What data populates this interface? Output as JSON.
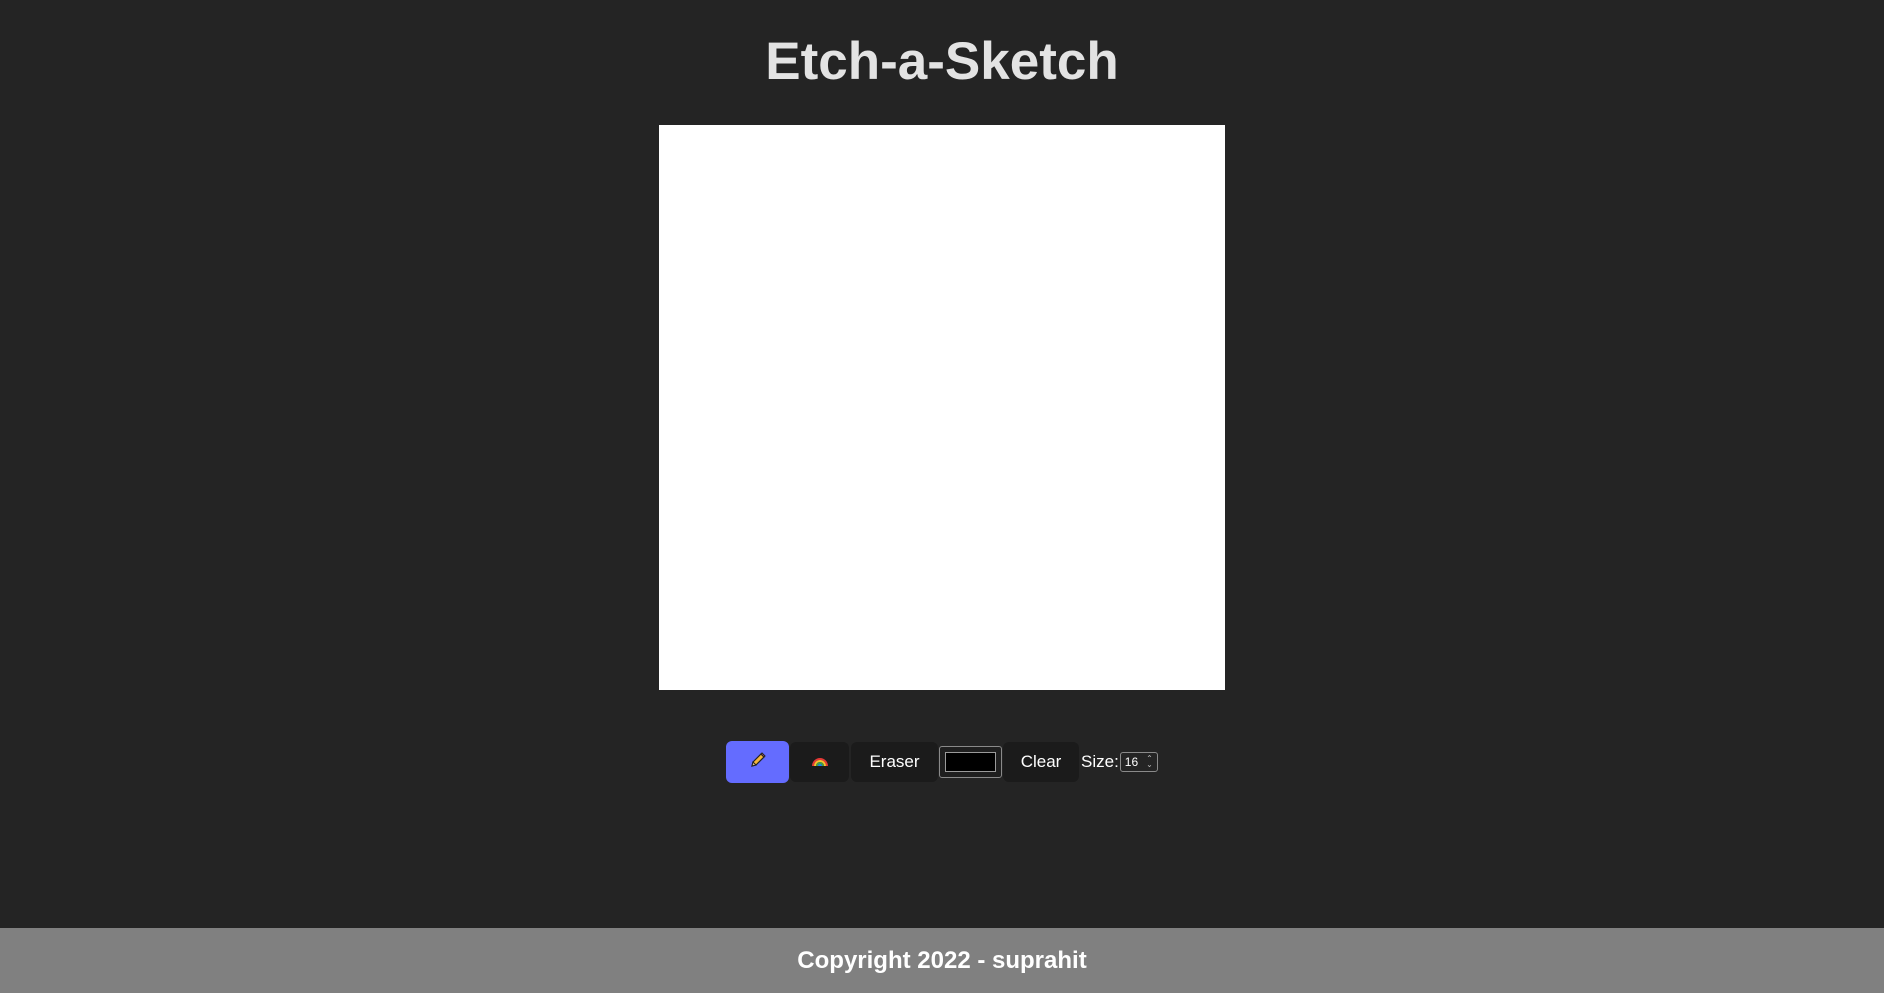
{
  "header": {
    "title": "Etch-a-Sketch"
  },
  "toolbar": {
    "pencil_icon": "pencil-icon",
    "rainbow_icon": "rainbow-icon",
    "eraser_label": "Eraser",
    "color_value": "#000000",
    "clear_label": "Clear",
    "size_label": "Size:",
    "size_value": "16",
    "active_tool": "pencil",
    "active_color": "#646cff"
  },
  "footer": {
    "text": "Copyright 2022 - suprahit"
  }
}
